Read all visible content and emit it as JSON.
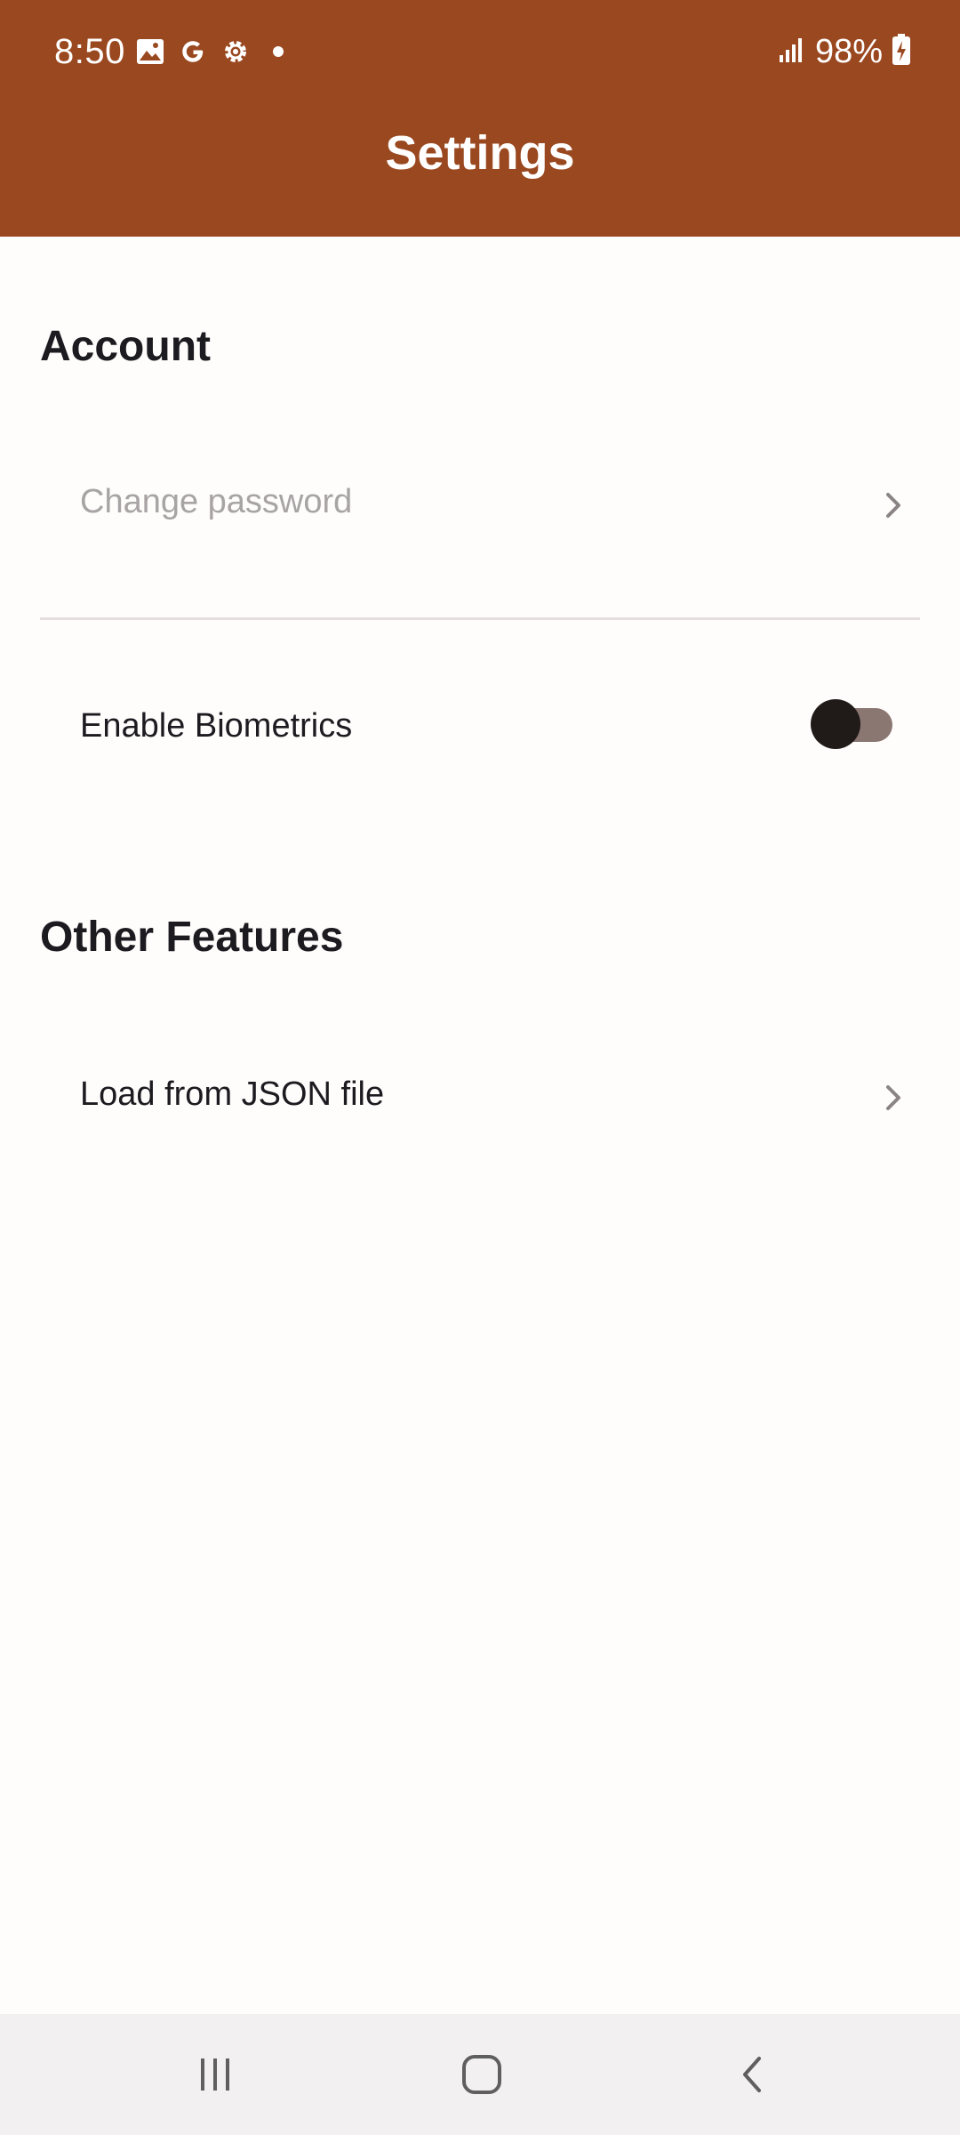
{
  "status_bar": {
    "time": "8:50",
    "battery": "98%",
    "left_icons": [
      "gallery-icon",
      "google-icon",
      "settings-gear-icon",
      "notification-dot-icon"
    ],
    "right_icons": [
      "signal-icon",
      "battery-charging-icon"
    ]
  },
  "app_bar": {
    "title": "Settings",
    "background_color": "#9a4820"
  },
  "sections": {
    "account": {
      "header": "Account",
      "change_password_label": "Change password",
      "biometrics_label": "Enable Biometrics",
      "biometrics_enabled": false
    },
    "other_features": {
      "header": "Other Features",
      "load_json_label": "Load from JSON file"
    }
  },
  "nav_bar": {
    "buttons": [
      "recents-icon",
      "home-icon",
      "back-icon"
    ]
  }
}
